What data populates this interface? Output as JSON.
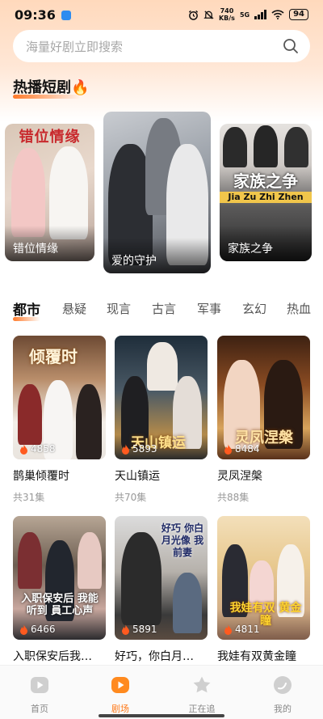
{
  "status_bar": {
    "time": "09:36",
    "net_speed": "740",
    "net_unit": "KB/s",
    "network_type": "5G",
    "battery": "94"
  },
  "search": {
    "placeholder": "海量好剧立即搜索",
    "icon": "search-icon"
  },
  "hot_section": {
    "title": "热播短剧🔥",
    "items": [
      {
        "title": "错位情缘",
        "poster_text": "错位情缘"
      },
      {
        "title": "爱的守护",
        "poster_text": "爱的守护"
      },
      {
        "title": "家族之争",
        "poster_text": "家族之争",
        "poster_pinyin": "Jia Zu Zhi Zhen"
      }
    ]
  },
  "categories": {
    "active_index": 0,
    "items": [
      "都市",
      "悬疑",
      "现言",
      "古言",
      "军事",
      "玄幻",
      "热血"
    ]
  },
  "dramas": [
    {
      "title": "鹊巢倾覆时",
      "views": "4858",
      "episodes": "共31集",
      "poster_text": "倾覆时"
    },
    {
      "title": "天山镇运",
      "views": "5893",
      "episodes": "共70集",
      "poster_text": "天山镇运"
    },
    {
      "title": "灵凤涅槃",
      "views": "8484",
      "episodes": "共88集",
      "poster_text": "灵凤涅槃"
    },
    {
      "title": "入职保安后我…",
      "views": "6466",
      "poster_text": "入职保安后 我能听到 員工心声"
    },
    {
      "title": "好巧，你白月…",
      "views": "5891",
      "poster_text": "好巧 你白月光像 我前妻"
    },
    {
      "title": "我娃有双黄金瞳",
      "views": "4811",
      "poster_text": "我娃有双 黄金瞳"
    }
  ],
  "bottom_nav": {
    "active_index": 1,
    "items": [
      {
        "label": "首页",
        "icon": "play-icon"
      },
      {
        "label": "剧场",
        "icon": "theater-icon"
      },
      {
        "label": "正在追",
        "icon": "star-icon"
      },
      {
        "label": "我的",
        "icon": "profile-icon"
      }
    ]
  },
  "colors": {
    "accent": "#ff7a1a",
    "header_gradient_top": "#ffd9bc"
  }
}
